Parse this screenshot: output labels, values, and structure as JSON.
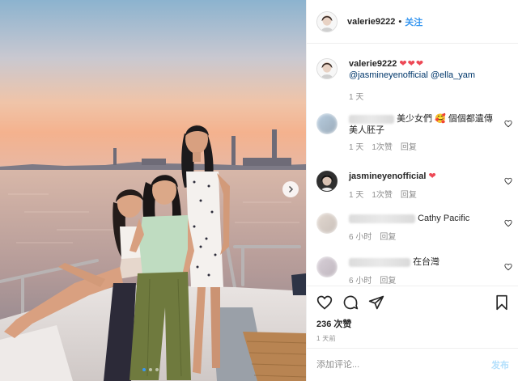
{
  "post": {
    "username": "valerie9222",
    "follow_separator": "•",
    "follow_label": "关注"
  },
  "caption": {
    "username": "valerie9222",
    "hearts": "❤❤❤",
    "mention_1": "@jasmineyenofficial",
    "mention_2": "@ella_yam",
    "time": "1 天"
  },
  "comments": [
    {
      "username_hidden": true,
      "text": "美少女們 🥰 個個都遺傳美人胚子",
      "time": "1 天",
      "likes": "1次赞",
      "reply": "回复"
    },
    {
      "username": "jasmineyenofficial",
      "text": "❤",
      "time": "1 天",
      "likes": "1次赞",
      "reply": "回复"
    },
    {
      "username_hidden": true,
      "text": "Cathy Pacific",
      "time": "6 小时",
      "reply": "回复"
    },
    {
      "username_hidden": true,
      "text": "在台灣",
      "time": "6 小时",
      "reply": "回复"
    }
  ],
  "likes_label": "236 次赞",
  "posted_ago": "1 天前",
  "composer": {
    "placeholder": "添加评论...",
    "post_label": "发布"
  },
  "carousel": {
    "slides": 3,
    "active_index": 0
  },
  "icons": {
    "like": "heart-outline-icon",
    "comment": "comment-bubble-icon",
    "share": "paper-plane-icon",
    "save": "bookmark-icon",
    "next": "chevron-right-icon"
  },
  "colors": {
    "accent": "#3897f0",
    "heart": "#ed4956",
    "muted": "#8e8e8e",
    "post_disabled": "#b2dffc"
  }
}
